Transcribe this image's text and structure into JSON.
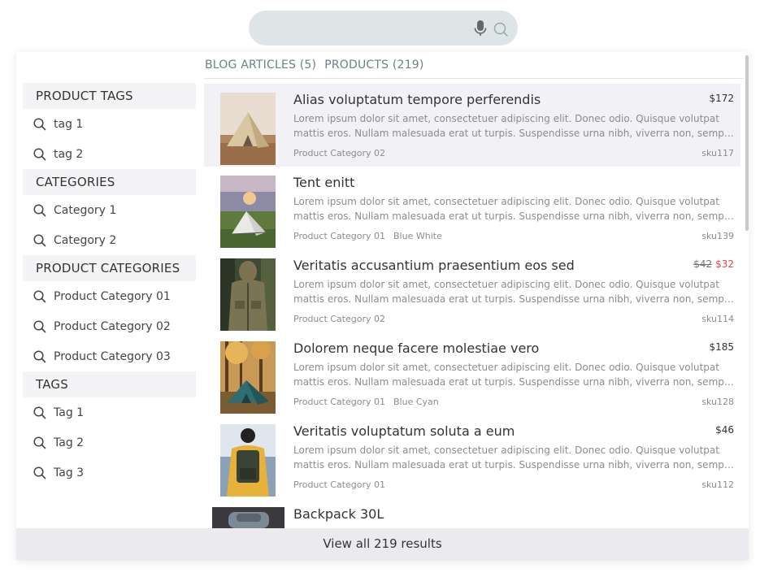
{
  "search": {
    "value": "",
    "placeholder": ""
  },
  "tabs": [
    {
      "label": "BLOG ARTICLES (5)"
    },
    {
      "label": "PRODUCTS (219)"
    }
  ],
  "sidebar": {
    "sections": [
      {
        "title": "PRODUCT TAGS",
        "items": [
          "tag 1",
          "tag 2"
        ]
      },
      {
        "title": "CATEGORIES",
        "items": [
          "Category 1",
          "Category 2"
        ]
      },
      {
        "title": "PRODUCT CATEGORIES",
        "items": [
          "Product Category 01",
          "Product Category 02",
          "Product Category 03"
        ]
      },
      {
        "title": "TAGS",
        "items": [
          "Tag 1",
          "Tag 2",
          "Tag 3"
        ]
      }
    ]
  },
  "results": [
    {
      "title": "Alias voluptatum tempore perferendis",
      "price": "$172",
      "old_price": "",
      "desc1": "Lorem ipsum dolor sit amet, consectetuer adipiscing elit. Donec odio. Quisque volutpat",
      "desc2": "mattis eros. Nullam malesuada erat ut turpis. Suspendisse urna nibh, viverra non, semper suscipit",
      "category": "Product Category 02",
      "tag": "",
      "sku": "sku117",
      "image": "tent-beige"
    },
    {
      "title": "Tent enitt",
      "price": "",
      "old_price": "",
      "desc1": "Lorem ipsum dolor sit amet, consectetuer adipiscing elit. Donec odio. Quisque volutpat",
      "desc2": "mattis eros. Nullam malesuada erat ut turpis. Suspendisse urna nibh, viverra non, semper suscipit",
      "category": "Product Category 01",
      "tag": "Blue White",
      "sku": "sku139",
      "image": "tent-white"
    },
    {
      "title": "Veritatis accusantium praesentium eos sed",
      "price": "$32",
      "old_price": "$42",
      "desc1": "Lorem ipsum dolor sit amet, consectetuer adipiscing elit. Donec odio. Quisque volutpat",
      "desc2": "mattis eros. Nullam malesuada erat ut turpis. Suspendisse urna nibh, viverra non, semper suscipit",
      "category": "Product Category 02",
      "tag": "",
      "sku": "sku114",
      "image": "jacket"
    },
    {
      "title": "Dolorem neque facere molestiae vero",
      "price": "$185",
      "old_price": "",
      "desc1": "Lorem ipsum dolor sit amet, consectetuer adipiscing elit. Donec odio. Quisque volutpat",
      "desc2": "mattis eros. Nullam malesuada erat ut turpis. Suspendisse urna nibh, viverra non, semper suscipit",
      "category": "Product Category 01",
      "tag": "Blue Cyan",
      "sku": "sku128",
      "image": "tent-forest"
    },
    {
      "title": "Veritatis voluptatum soluta a eum",
      "price": "$46",
      "old_price": "",
      "desc1": "Lorem ipsum dolor sit amet, consectetuer adipiscing elit. Donec odio. Quisque volutpat",
      "desc2": "mattis eros. Nullam malesuada erat ut turpis. Suspendisse urna nibh, viverra non, semper suscipit",
      "category": "Product Category 01",
      "tag": "",
      "sku": "sku112",
      "image": "backpack-person"
    },
    {
      "title": "Backpack 30L",
      "price": "",
      "old_price": "",
      "desc1": "",
      "desc2": "",
      "category": "",
      "tag": "",
      "sku": "",
      "image": "backpack"
    }
  ],
  "footer": {
    "label": "View all 219 results"
  },
  "colors": {
    "search_bg": "#dde5e7",
    "active_row": "#f2f2f6",
    "sale": "#d9434b",
    "tab_text": "#6b8186",
    "footer_bg": "#ebebef"
  }
}
